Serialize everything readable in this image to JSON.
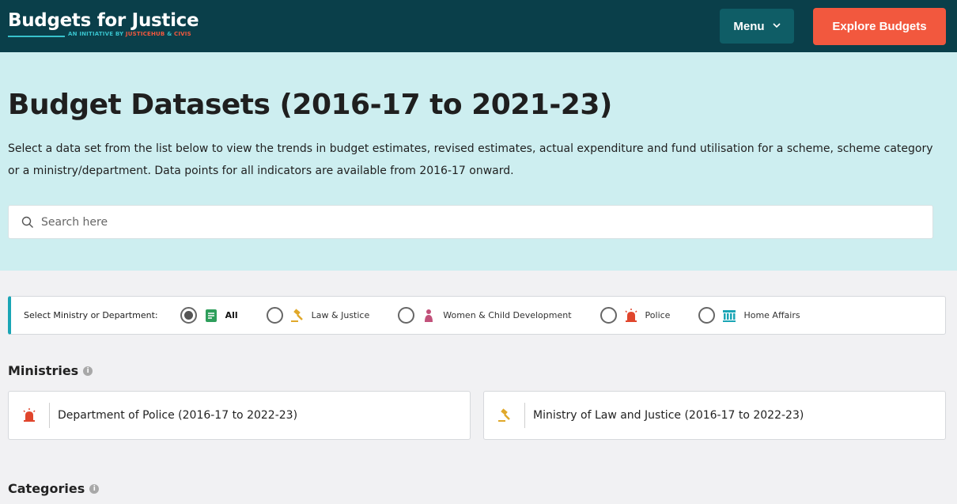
{
  "header": {
    "logo_title": "Budgets for Justice",
    "logo_sub_prefix": "AN INITIATIVE BY ",
    "logo_sub_org1": "JUSTICEHUB",
    "logo_sub_amp": " & ",
    "logo_sub_org2": "CIVIS",
    "menu_label": "Menu",
    "explore_label": "Explore Budgets"
  },
  "hero": {
    "title": "Budget Datasets (2016-17 to 2021-23)",
    "description": "Select a data set from the list below to view the trends in budget estimates, revised estimates, actual expenditure and fund utilisation for a scheme, scheme category or a ministry/department. Data points for all indicators are available from 2016-17 onward.",
    "search_placeholder": "Search here"
  },
  "filter": {
    "label": "Select Ministry or Department:",
    "options": [
      {
        "label": "All",
        "icon": "document-icon",
        "selected": true
      },
      {
        "label": "Law & Justice",
        "icon": "gavel-icon",
        "selected": false
      },
      {
        "label": "Women & Child Development",
        "icon": "woman-icon",
        "selected": false
      },
      {
        "label": "Police",
        "icon": "siren-icon",
        "selected": false
      },
      {
        "label": "Home Affairs",
        "icon": "building-icon",
        "selected": false
      }
    ]
  },
  "ministries": {
    "title": "Ministries",
    "items": [
      {
        "label": "Department of Police (2016-17 to 2022-23)",
        "icon": "siren-icon"
      },
      {
        "label": "Ministry of Law and Justice (2016-17 to 2022-23)",
        "icon": "gavel-icon"
      }
    ]
  },
  "categories": {
    "title": "Categories"
  },
  "colors": {
    "header_bg": "#0a3f4a",
    "menu_bg": "#0f5d66",
    "accent": "#f2583e",
    "hero_bg": "#cdeef0",
    "teal": "#1aa5b5"
  }
}
